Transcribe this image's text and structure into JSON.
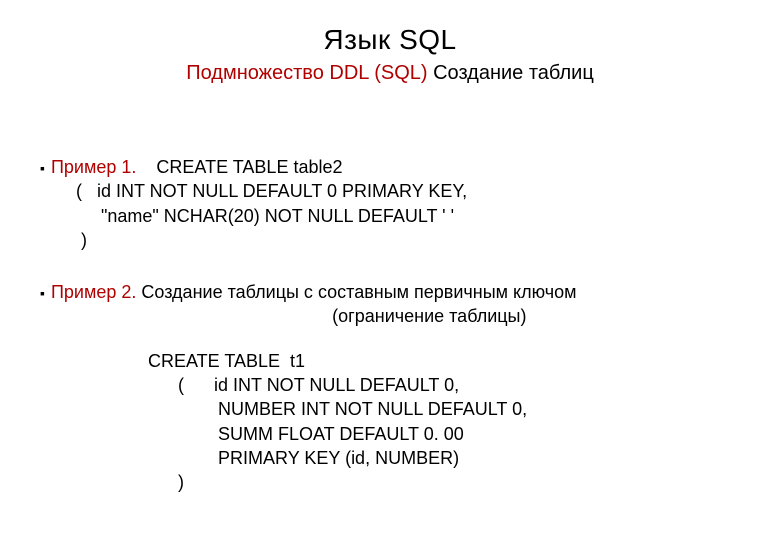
{
  "title": "Язык SQL",
  "subtitle": {
    "red": "Подмножество DDL (SQL)",
    "rest": " Создание таблиц"
  },
  "bullet": "▪",
  "example1": {
    "label": "Пример 1.",
    "code": "CREATE TABLE table2\n     (   id INT NOT NULL DEFAULT 0 PRIMARY KEY,\n          \"name\" NCHAR(20) NOT NULL DEFAULT ' '\n      )"
  },
  "example2": {
    "label": "Пример 2.",
    "desc_line1": " Создание таблицы с составным первичным ключом",
    "desc_line2": "(ограничение таблицы)",
    "code": "CREATE TABLE  t1\n      (      id INT NOT NULL DEFAULT 0,\n              NUMBER INT NOT NULL DEFAULT 0,\n              SUMM FLOAT DEFAULT 0. 00\n              PRIMARY KEY (id, NUMBER)\n      )"
  }
}
